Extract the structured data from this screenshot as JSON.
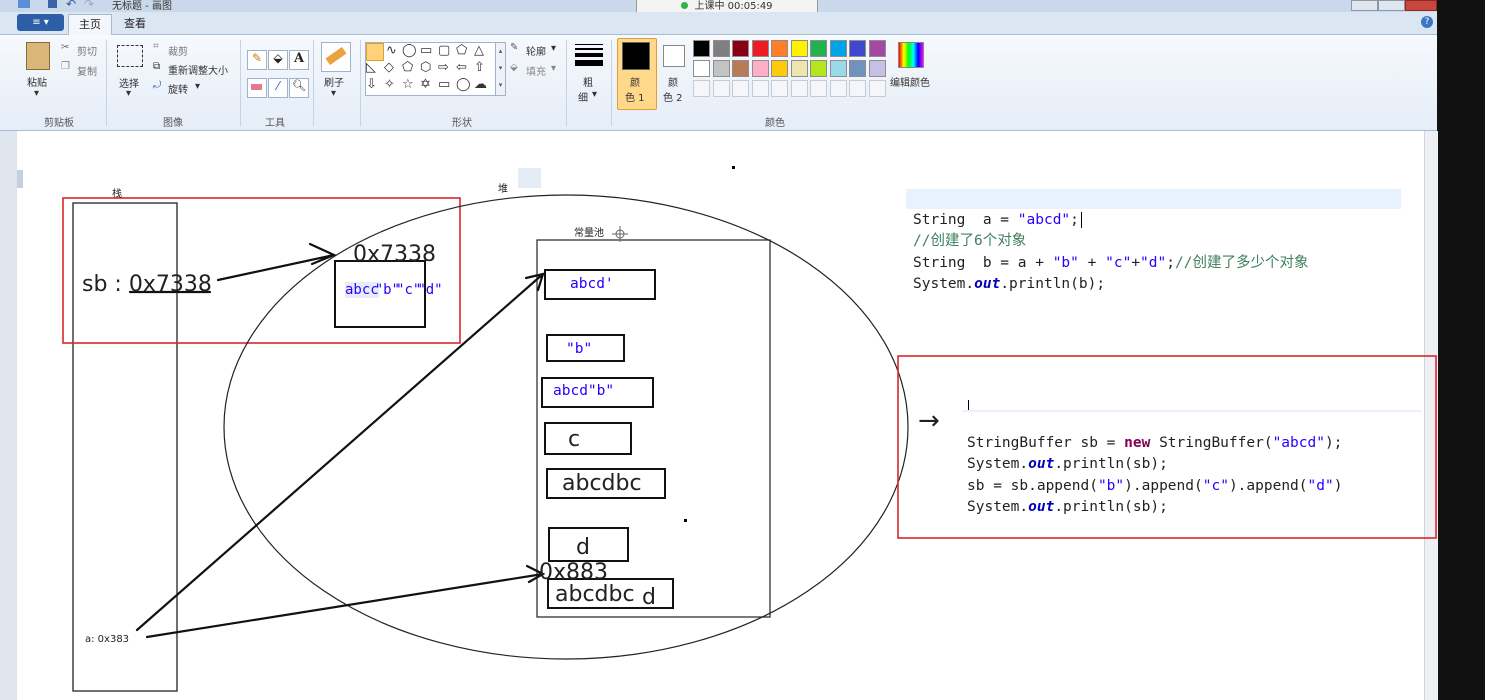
{
  "window": {
    "title": "无标题 - 画图",
    "timer": "上课中 00:05:49"
  },
  "tabs": {
    "file": "≡ ▾",
    "home": "主页",
    "view": "查看"
  },
  "ribbon": {
    "clipboard": {
      "paste": "粘贴",
      "cut": "剪切",
      "copy": "复制",
      "label": "剪贴板"
    },
    "image": {
      "select": "选择",
      "crop": "裁剪",
      "resize": "重新调整大小",
      "rotate": "旋转",
      "label": "图像"
    },
    "tools": {
      "label": "工具"
    },
    "brush": {
      "label": "刷子"
    },
    "shapes": {
      "outline": "轮廓",
      "fill": "填充",
      "label": "形状"
    },
    "size": {
      "label1": "粗",
      "label2": "细"
    },
    "colors": {
      "color1_a": "颜",
      "color1_b": "色 1",
      "color2_a": "颜",
      "color2_b": "色 2",
      "edit": "编辑颜色",
      "label": "颜色",
      "palette_row1": [
        "#000000",
        "#7f7f7f",
        "#880015",
        "#ed1c24",
        "#ff7f27",
        "#fff200",
        "#22b14c",
        "#00a2e8",
        "#3f48cc",
        "#a349a4"
      ],
      "palette_row2": [
        "#ffffff",
        "#c3c3c3",
        "#b97a57",
        "#ffaec9",
        "#ffc90e",
        "#efe4b0",
        "#b5e61d",
        "#99d9ea",
        "#7092be",
        "#c8bfe7"
      ]
    }
  },
  "drawing": {
    "stack_label": "栈",
    "heap_label": "堆",
    "pool_label": "常量池",
    "sb_ref": "sb : 0x7338",
    "heap_addr": "0x7338",
    "heap_box_text_1": "abcc",
    "heap_box_text_2": "\"b\"",
    "heap_box_text_3": "\"c\"",
    "heap_box_text_4": "\"d\"",
    "pool_items": [
      "abcd'",
      "\"b\"",
      "abcd\"b\"",
      "c",
      "abcdbc",
      "d",
      "abcdbc"
    ],
    "pool_item_last_suffix": "d",
    "addr_883": "0x883",
    "a_ref": "a: 0x383",
    "arrow": "→"
  },
  "code1": {
    "line1_kw": "String",
    "line1_rest": "  a = ",
    "line1_str": "\"abcd\"",
    "line1_end": ";",
    "line2": "//创建了6个对象",
    "line3_kw": "String",
    "line3_a": "  b = a + ",
    "line3_s1": "\"b\"",
    "line3_b": " + ",
    "line3_s2": "\"c\"",
    "line3_c": "+",
    "line3_s3": "\"d\"",
    "line3_d": ";",
    "line3_cm": "//创建了多少个对象",
    "line4_a": "System.",
    "line4_out": "out",
    "line4_b": ".println(b);"
  },
  "code2": {
    "line1_a": "StringBuffer sb = ",
    "line1_new": "new",
    "line1_b": " StringBuffer(",
    "line1_str": "\"abcd\"",
    "line1_c": ");",
    "line2_a": "System.",
    "line2_out": "out",
    "line2_b": ".println(sb);",
    "line3_a": "sb = sb.append(",
    "line3_s1": "\"b\"",
    "line3_b": ").append(",
    "line3_s2": "\"c\"",
    "line3_c": ").append(",
    "line3_s3": "\"d\"",
    "line3_d": ")",
    "line4_a": "System.",
    "line4_out": "out",
    "line4_b": ".println(sb);"
  }
}
